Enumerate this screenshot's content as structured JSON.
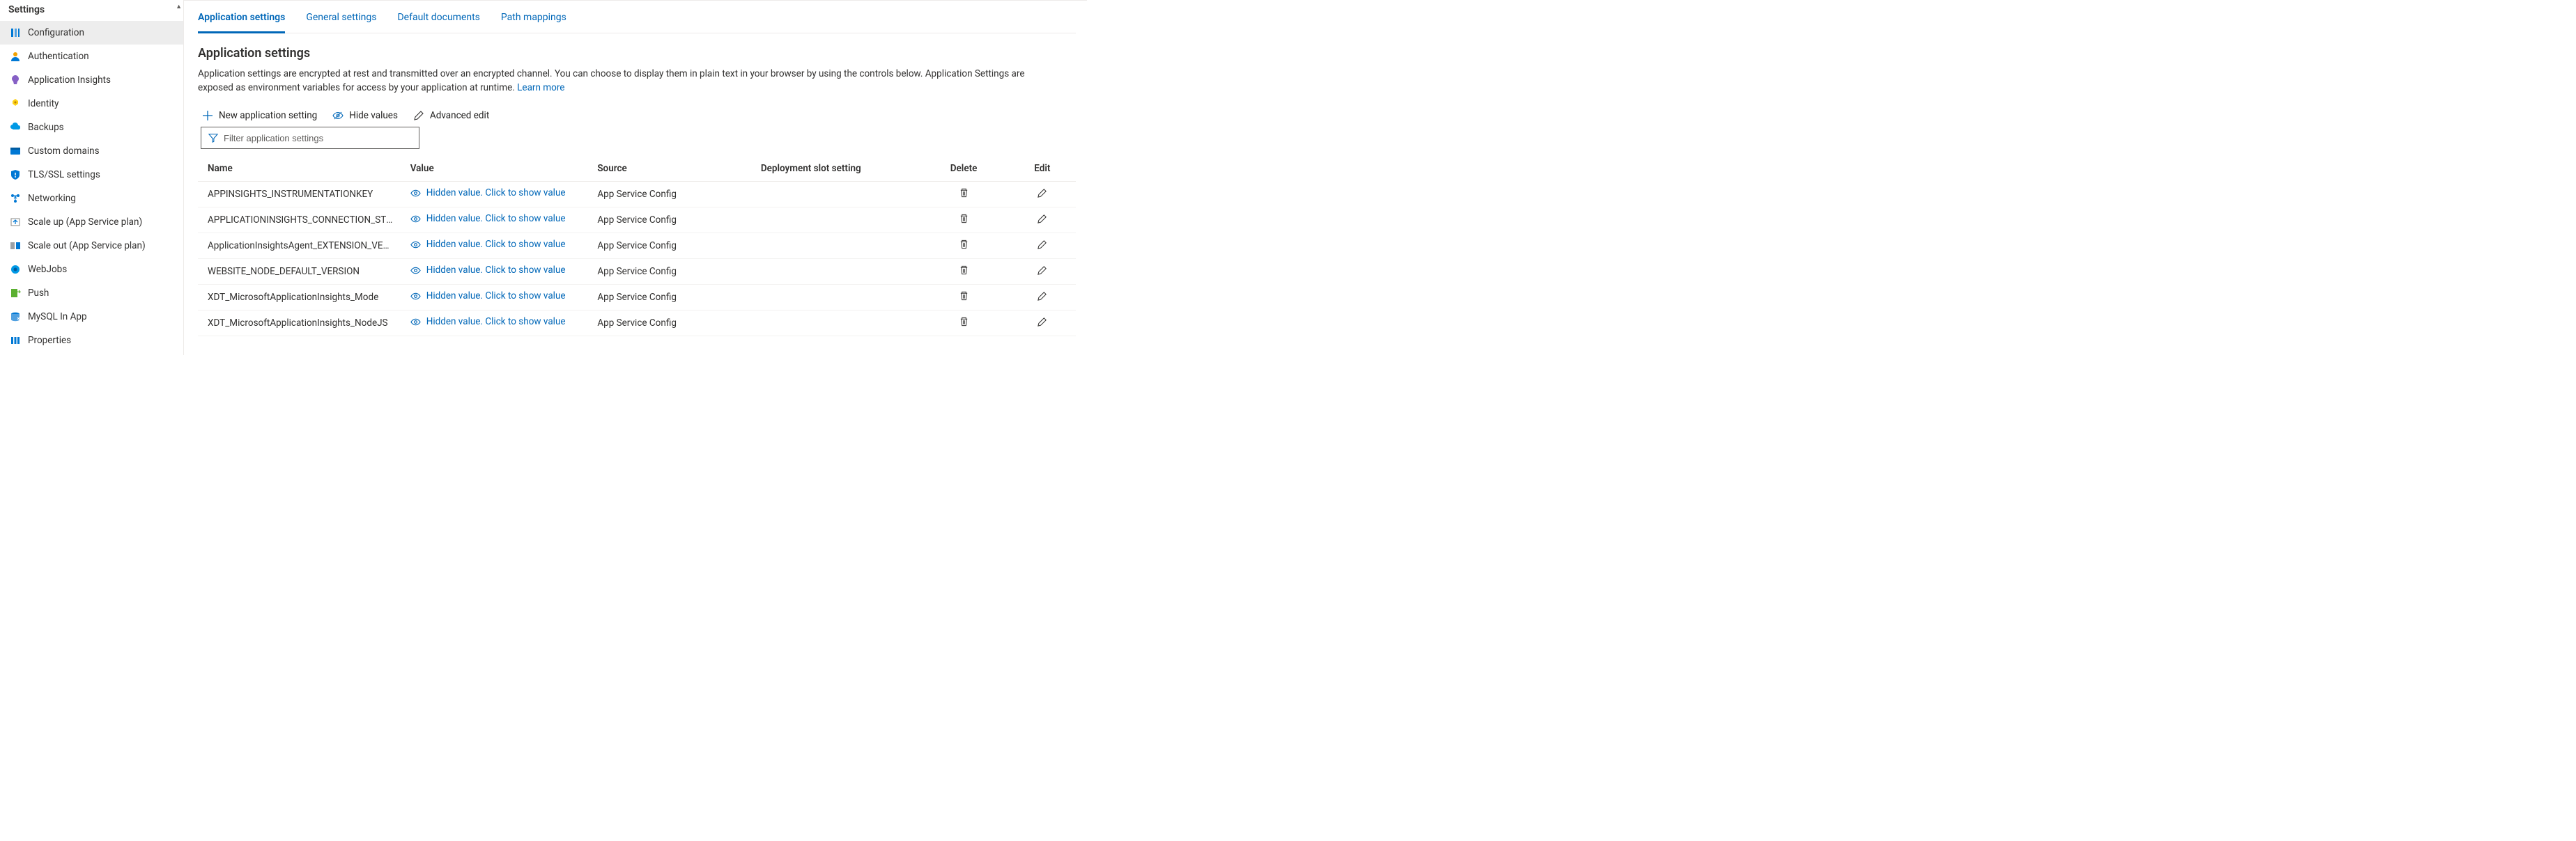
{
  "sidebar": {
    "title": "Settings",
    "items": [
      {
        "label": "Configuration"
      },
      {
        "label": "Authentication"
      },
      {
        "label": "Application Insights"
      },
      {
        "label": "Identity"
      },
      {
        "label": "Backups"
      },
      {
        "label": "Custom domains"
      },
      {
        "label": "TLS/SSL settings"
      },
      {
        "label": "Networking"
      },
      {
        "label": "Scale up (App Service plan)"
      },
      {
        "label": "Scale out (App Service plan)"
      },
      {
        "label": "WebJobs"
      },
      {
        "label": "Push"
      },
      {
        "label": "MySQL In App"
      },
      {
        "label": "Properties"
      }
    ]
  },
  "tabs": [
    "Application settings",
    "General settings",
    "Default documents",
    "Path mappings"
  ],
  "section": {
    "title": "Application settings",
    "description": "Application settings are encrypted at rest and transmitted over an encrypted channel. You can choose to display them in plain text in your browser by using the controls below. Application Settings are exposed as environment variables for access by your application at runtime. ",
    "learn_more": "Learn more"
  },
  "toolbar": {
    "new_setting": "New application setting",
    "hide_values": "Hide values",
    "advanced_edit": "Advanced edit"
  },
  "filter_placeholder": "Filter application settings",
  "table": {
    "headers": {
      "name": "Name",
      "value": "Value",
      "source": "Source",
      "slot": "Deployment slot setting",
      "delete": "Delete",
      "edit": "Edit"
    },
    "hidden_text": "Hidden value. Click to show value",
    "rows": [
      {
        "name": "APPINSIGHTS_INSTRUMENTATIONKEY",
        "source": "App Service Config"
      },
      {
        "name": "APPLICATIONINSIGHTS_CONNECTION_STRING",
        "source": "App Service Config"
      },
      {
        "name": "ApplicationInsightsAgent_EXTENSION_VERSION",
        "source": "App Service Config"
      },
      {
        "name": "WEBSITE_NODE_DEFAULT_VERSION",
        "source": "App Service Config"
      },
      {
        "name": "XDT_MicrosoftApplicationInsights_Mode",
        "source": "App Service Config"
      },
      {
        "name": "XDT_MicrosoftApplicationInsights_NodeJS",
        "source": "App Service Config"
      }
    ]
  }
}
